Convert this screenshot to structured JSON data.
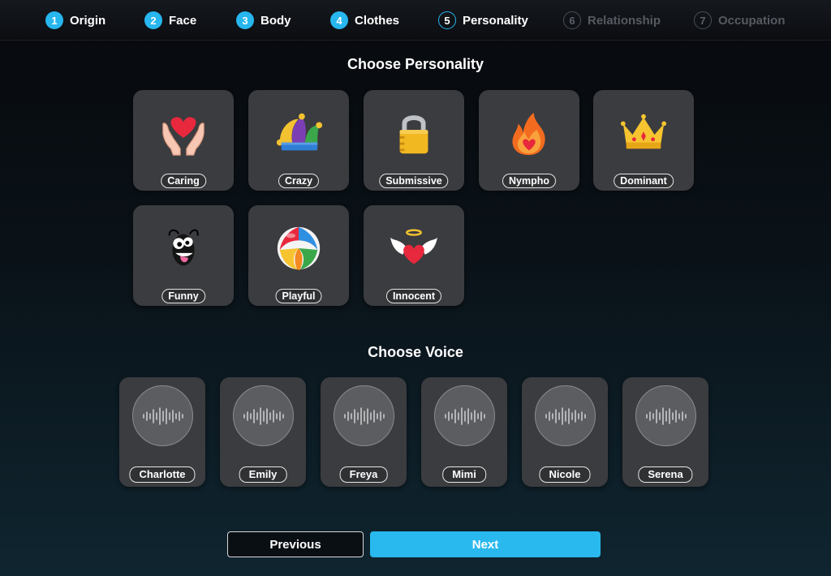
{
  "steps": [
    {
      "num": "1",
      "label": "Origin",
      "state": "done"
    },
    {
      "num": "2",
      "label": "Face",
      "state": "done"
    },
    {
      "num": "3",
      "label": "Body",
      "state": "done"
    },
    {
      "num": "4",
      "label": "Clothes",
      "state": "done"
    },
    {
      "num": "5",
      "label": "Personality",
      "state": "current"
    },
    {
      "num": "6",
      "label": "Relationship",
      "state": "todo"
    },
    {
      "num": "7",
      "label": "Occupation",
      "state": "todo"
    }
  ],
  "personality": {
    "title": "Choose Personality",
    "options": [
      {
        "label": "Caring",
        "icon": "heart-hands-icon"
      },
      {
        "label": "Crazy",
        "icon": "jester-hat-icon"
      },
      {
        "label": "Submissive",
        "icon": "padlock-icon"
      },
      {
        "label": "Nympho",
        "icon": "heart-flame-icon"
      },
      {
        "label": "Dominant",
        "icon": "crown-icon"
      },
      {
        "label": "Funny",
        "icon": "silly-face-icon"
      },
      {
        "label": "Playful",
        "icon": "beach-ball-icon"
      },
      {
        "label": "Innocent",
        "icon": "winged-heart-icon"
      }
    ]
  },
  "voice": {
    "title": "Choose Voice",
    "options": [
      {
        "label": "Charlotte",
        "icon": "soundwave-icon"
      },
      {
        "label": "Emily",
        "icon": "soundwave-icon"
      },
      {
        "label": "Freya",
        "icon": "soundwave-icon"
      },
      {
        "label": "Mimi",
        "icon": "soundwave-icon"
      },
      {
        "label": "Nicole",
        "icon": "soundwave-icon"
      },
      {
        "label": "Serena",
        "icon": "soundwave-icon"
      }
    ]
  },
  "nav": {
    "previous_label": "Previous",
    "next_label": "Next"
  },
  "colors": {
    "accent": "#29b9ee",
    "card": "#3b3c3f",
    "inactive_step": "#565b62"
  }
}
